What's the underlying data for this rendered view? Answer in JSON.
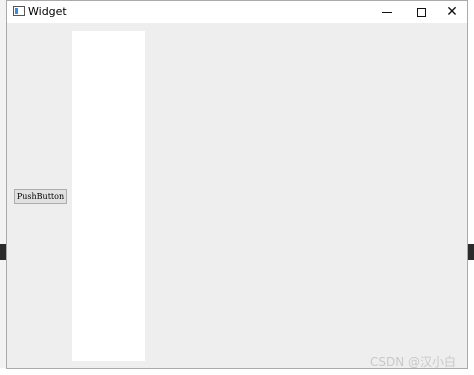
{
  "window": {
    "title": "Widget",
    "app_icon": "app-window-icon",
    "controls": {
      "minimize_icon": "minimize-icon",
      "maximize_icon": "maximize-icon",
      "close_icon": "close-icon",
      "close_glyph": "✕"
    }
  },
  "widgets": {
    "push_button_label": "PushButton"
  },
  "watermark": "CSDN @汉小白"
}
